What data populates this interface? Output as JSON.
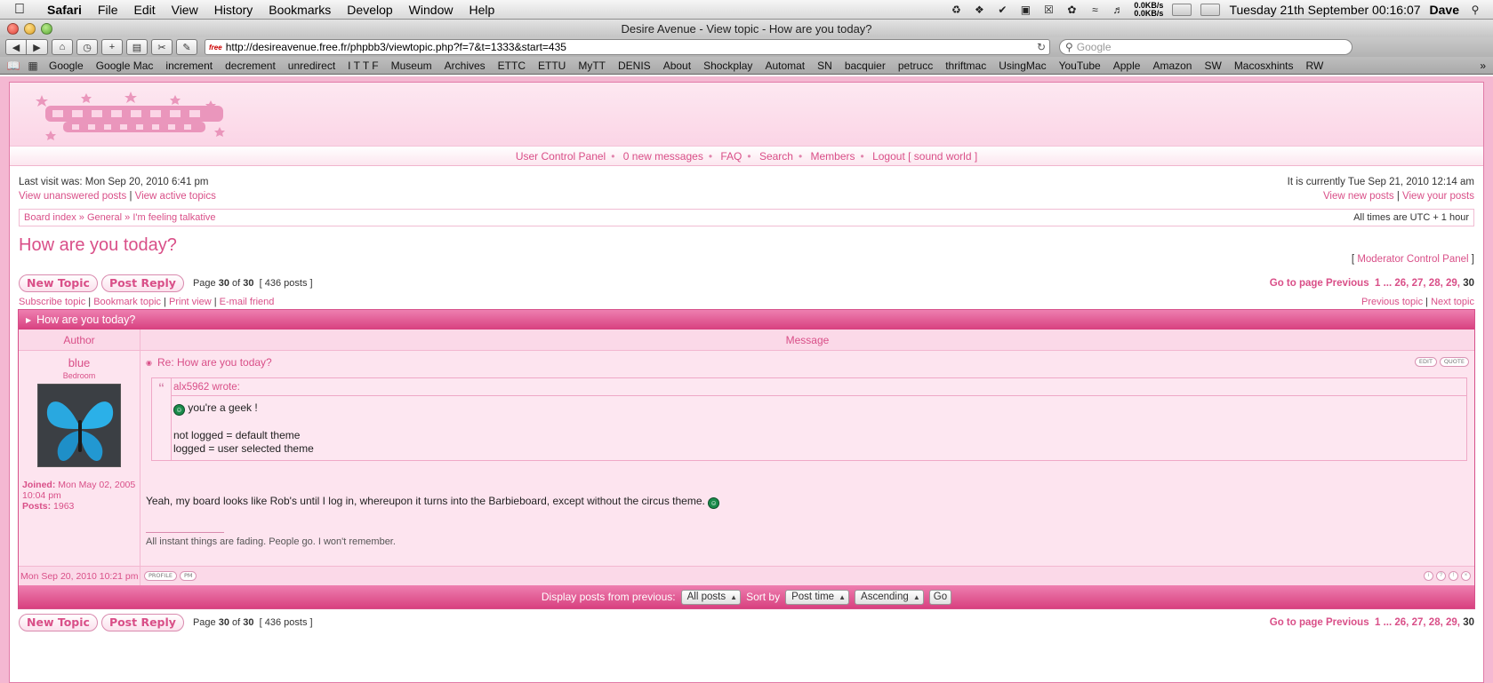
{
  "menubar": {
    "app": "Safari",
    "items": [
      "File",
      "Edit",
      "View",
      "History",
      "Bookmarks",
      "Develop",
      "Window",
      "Help"
    ],
    "netspeed_up": "0.0KB/s",
    "netspeed_down": "0.0KB/s",
    "clock": "Tuesday 21th September  00:16:07",
    "user": "Dave"
  },
  "window": {
    "title": "Desire Avenue - View topic - How are you today?"
  },
  "toolbar": {
    "url": "http://desireavenue.free.fr/phpbb3/viewtopic.php?f=7&t=1333&start=435",
    "favicon_text": "free",
    "search_placeholder": "Google"
  },
  "bookmarks": [
    "Google",
    "Google Mac",
    "increment",
    "decrement",
    "unredirect",
    "I T T F",
    "Museum",
    "Archives",
    "ETTC",
    "ETTU",
    "MyTT",
    "DENIS",
    "About",
    "Shockplay",
    "Automat",
    "SN",
    "bacquier",
    "petrucc",
    "thriftmac",
    "UsingMac",
    "YouTube",
    "Apple",
    "Amazon",
    "SW",
    "Macosxhints",
    "RW"
  ],
  "bookmarks_more": "»",
  "nav": {
    "links": [
      "User Control Panel",
      "0 new messages",
      "FAQ",
      "Search",
      "Members",
      "Logout [ sound world ]"
    ]
  },
  "visit": {
    "last_visit": "Last visit was: Mon Sep 20, 2010 6:41 pm",
    "view_unanswered": "View unanswered posts",
    "view_active": "View active topics",
    "current_time": "It is currently Tue Sep 21, 2010 12:14 am",
    "view_new": "View new posts",
    "view_yours": "View your posts"
  },
  "breadcrumb": {
    "items": [
      "Board index",
      "General",
      "I'm feeling talkative"
    ],
    "sep": " » ",
    "timezone": "All times are UTC + 1 hour"
  },
  "topic": {
    "title": "How are you today?",
    "mcp": "Moderator Control Panel"
  },
  "actions": {
    "new_topic": "New Topic",
    "post_reply": "Post Reply",
    "page_label": "Page",
    "page_current": "30",
    "page_of": "of",
    "page_total": "30",
    "posts_count": "[ 436 posts ]",
    "goto": "Go to page",
    "previous": "Previous",
    "pages": [
      "1",
      "...",
      "26,",
      "27,",
      "28,",
      "29,"
    ],
    "current_page": "30"
  },
  "topic_links": {
    "subscribe": "Subscribe topic",
    "bookmark": "Bookmark topic",
    "print": "Print view",
    "email": "E-mail friend",
    "prev_topic": "Previous topic",
    "next_topic": "Next topic"
  },
  "post_table": {
    "header": "How are you today?",
    "col_author": "Author",
    "col_message": "Message"
  },
  "post": {
    "author": "blue",
    "rank": "Bedroom",
    "joined_label": "Joined:",
    "joined": "Mon May 02, 2005 10:04 pm",
    "posts_label": "Posts:",
    "posts": "1963",
    "subject": "Re: How are you today?",
    "edit": "EDIT",
    "quote_btn": "QUOTE",
    "quote_author": "alx5962 wrote:",
    "quote_line1": "you're a geek !",
    "quote_line2": "not logged = default theme",
    "quote_line3": "logged = user selected theme",
    "text": "Yeah, my board looks like Rob's until I log in, whereupon it turns into the Barbieboard, except without the circus theme.",
    "signature": "All instant things are fading. People go. I won't remember.",
    "date": "Mon Sep 20, 2010 10:21 pm",
    "profile_btn": "PROFILE",
    "pm_btn": "PM",
    "smiley": "geek"
  },
  "display": {
    "label": "Display posts from previous:",
    "from_value": "All posts",
    "sort_label": "Sort by",
    "sort_value": "Post time",
    "order_value": "Ascending",
    "go": "Go"
  },
  "colors": {
    "accent": "#d94f88",
    "header_bg": "#e0508f",
    "post_bg": "#fde4ef"
  }
}
